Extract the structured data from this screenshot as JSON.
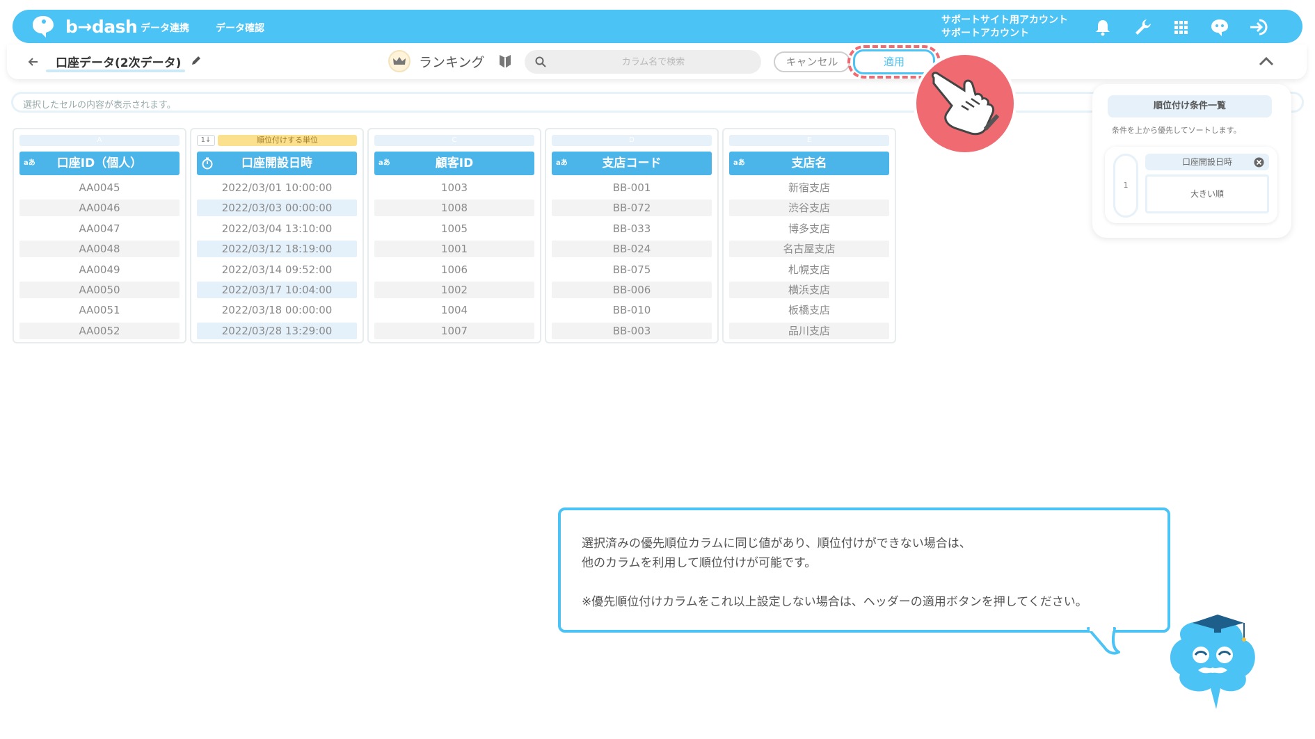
{
  "header": {
    "logo_text": "b→dash",
    "nav": [
      "データ連携",
      "データ確認"
    ],
    "account_line1": "サポートサイト用アカウント",
    "account_line2": "サポートアカウント"
  },
  "toolbar": {
    "datasource_title": "口座データ(2次データ)",
    "mode_label": "ランキング",
    "search_placeholder": "カラム名で検索",
    "cancel_label": "キャンセル",
    "apply_label": "適用"
  },
  "cell_viewer": {
    "placeholder": "選択したセルの内容が表示されます。"
  },
  "table": {
    "columns": [
      {
        "letter": "A",
        "type": "aあ",
        "header": "口座ID（個人）",
        "cells": [
          "AA0045",
          "AA0046",
          "AA0047",
          "AA0048",
          "AA0049",
          "AA0050",
          "AA0051",
          "AA0052"
        ]
      },
      {
        "letter": "順位付けする単位",
        "rank_chip": "1↓",
        "header": "口座開設日時",
        "cells": [
          "2022/03/01 10:00:00",
          "2022/03/03 00:00:00",
          "2022/03/04 13:10:00",
          "2022/03/12 18:19:00",
          "2022/03/14 09:52:00",
          "2022/03/17 10:04:00",
          "2022/03/18 00:00:00",
          "2022/03/28 13:29:00"
        ]
      },
      {
        "letter": "C",
        "type": "aあ",
        "header": "顧客ID",
        "cells": [
          "1003",
          "1008",
          "1005",
          "1001",
          "1006",
          "1002",
          "1004",
          "1007"
        ]
      },
      {
        "letter": "D",
        "type": "aあ",
        "header": "支店コード",
        "cells": [
          "BB-001",
          "BB-072",
          "BB-033",
          "BB-024",
          "BB-075",
          "BB-006",
          "BB-010",
          "BB-003"
        ]
      },
      {
        "letter": "E",
        "type": "aあ",
        "header": "支店名",
        "cells": [
          "新宿支店",
          "渋谷支店",
          "博多支店",
          "名古屋支店",
          "札幌支店",
          "横浜支店",
          "板橋支店",
          "品川支店"
        ]
      }
    ]
  },
  "panel": {
    "title": "順位付け条件一覧",
    "note": "条件を上から優先してソートします。",
    "conditions": [
      {
        "index": "1",
        "column": "口座開設日時",
        "order": "大きい順"
      }
    ]
  },
  "bubble": {
    "line1": "選択済みの優先順位カラムに同じ値があり、順位付けができない場合は、",
    "line2": "他のカラムを利用して順位付けが可能です。",
    "line3": "※優先順位付けカラムをこれ以上設定しない場合は、ヘッダーの適用ボタンを押してください。"
  },
  "colors": {
    "accent": "#4cc3f5",
    "header_cell": "#4bb5ea",
    "highlight": "#f06a72",
    "rank_band": "#fbe08d"
  },
  "icons": [
    "bell-icon",
    "wrench-icon",
    "grid-icon",
    "chat-icon",
    "logout-icon",
    "crown-icon",
    "leaf-icon",
    "search-icon",
    "pencil-icon",
    "chevron-up-icon",
    "hand-pointer-icon",
    "mascot-icon"
  ]
}
